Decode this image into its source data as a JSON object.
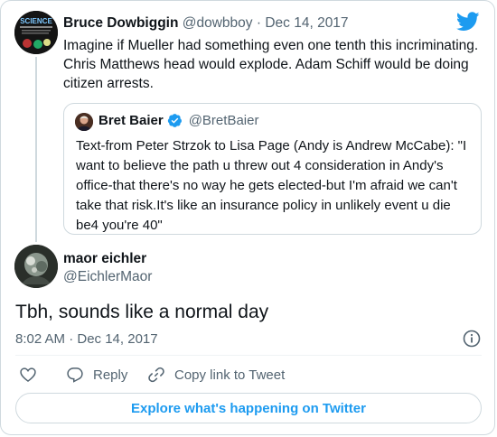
{
  "parent_tweet": {
    "display_name": "Bruce Dowbiggin",
    "handle": "@dowbboy",
    "separator": "·",
    "date": "Dec 14, 2017",
    "text": "Imagine if Mueller had something even one tenth this incriminating. Chris Matthews head would explode. Adam Schiff would be doing citizen arrests.",
    "avatar_text": "SCIENCE"
  },
  "quoted_tweet": {
    "display_name": "Bret Baier",
    "handle": "@BretBaier",
    "verified": true,
    "text": "Text-from Peter Strzok to Lisa Page (Andy is Andrew McCabe): \"I want to believe the path u threw out 4 consideration in Andy's office-that there's no way he gets elected-but I'm afraid we can't take that risk.It's like an insurance policy in unlikely event u die be4 you're 40\""
  },
  "main_tweet": {
    "display_name": "maor eichler",
    "handle": "@EichlerMaor",
    "text": "Tbh, sounds like a normal day",
    "timestamp": "8:02 AM · Dec 14, 2017"
  },
  "actions": {
    "reply_label": "Reply",
    "copy_link_label": "Copy link to Tweet"
  },
  "explore_button": "Explore what's happening on Twitter",
  "colors": {
    "accent": "#1d9bf0",
    "text_primary": "#0f1419",
    "text_secondary": "#536471",
    "border": "#cfd9de"
  },
  "icons": [
    "twitter-bird-icon",
    "verified-badge-icon",
    "info-icon",
    "heart-icon",
    "reply-icon",
    "copy-link-icon"
  ]
}
